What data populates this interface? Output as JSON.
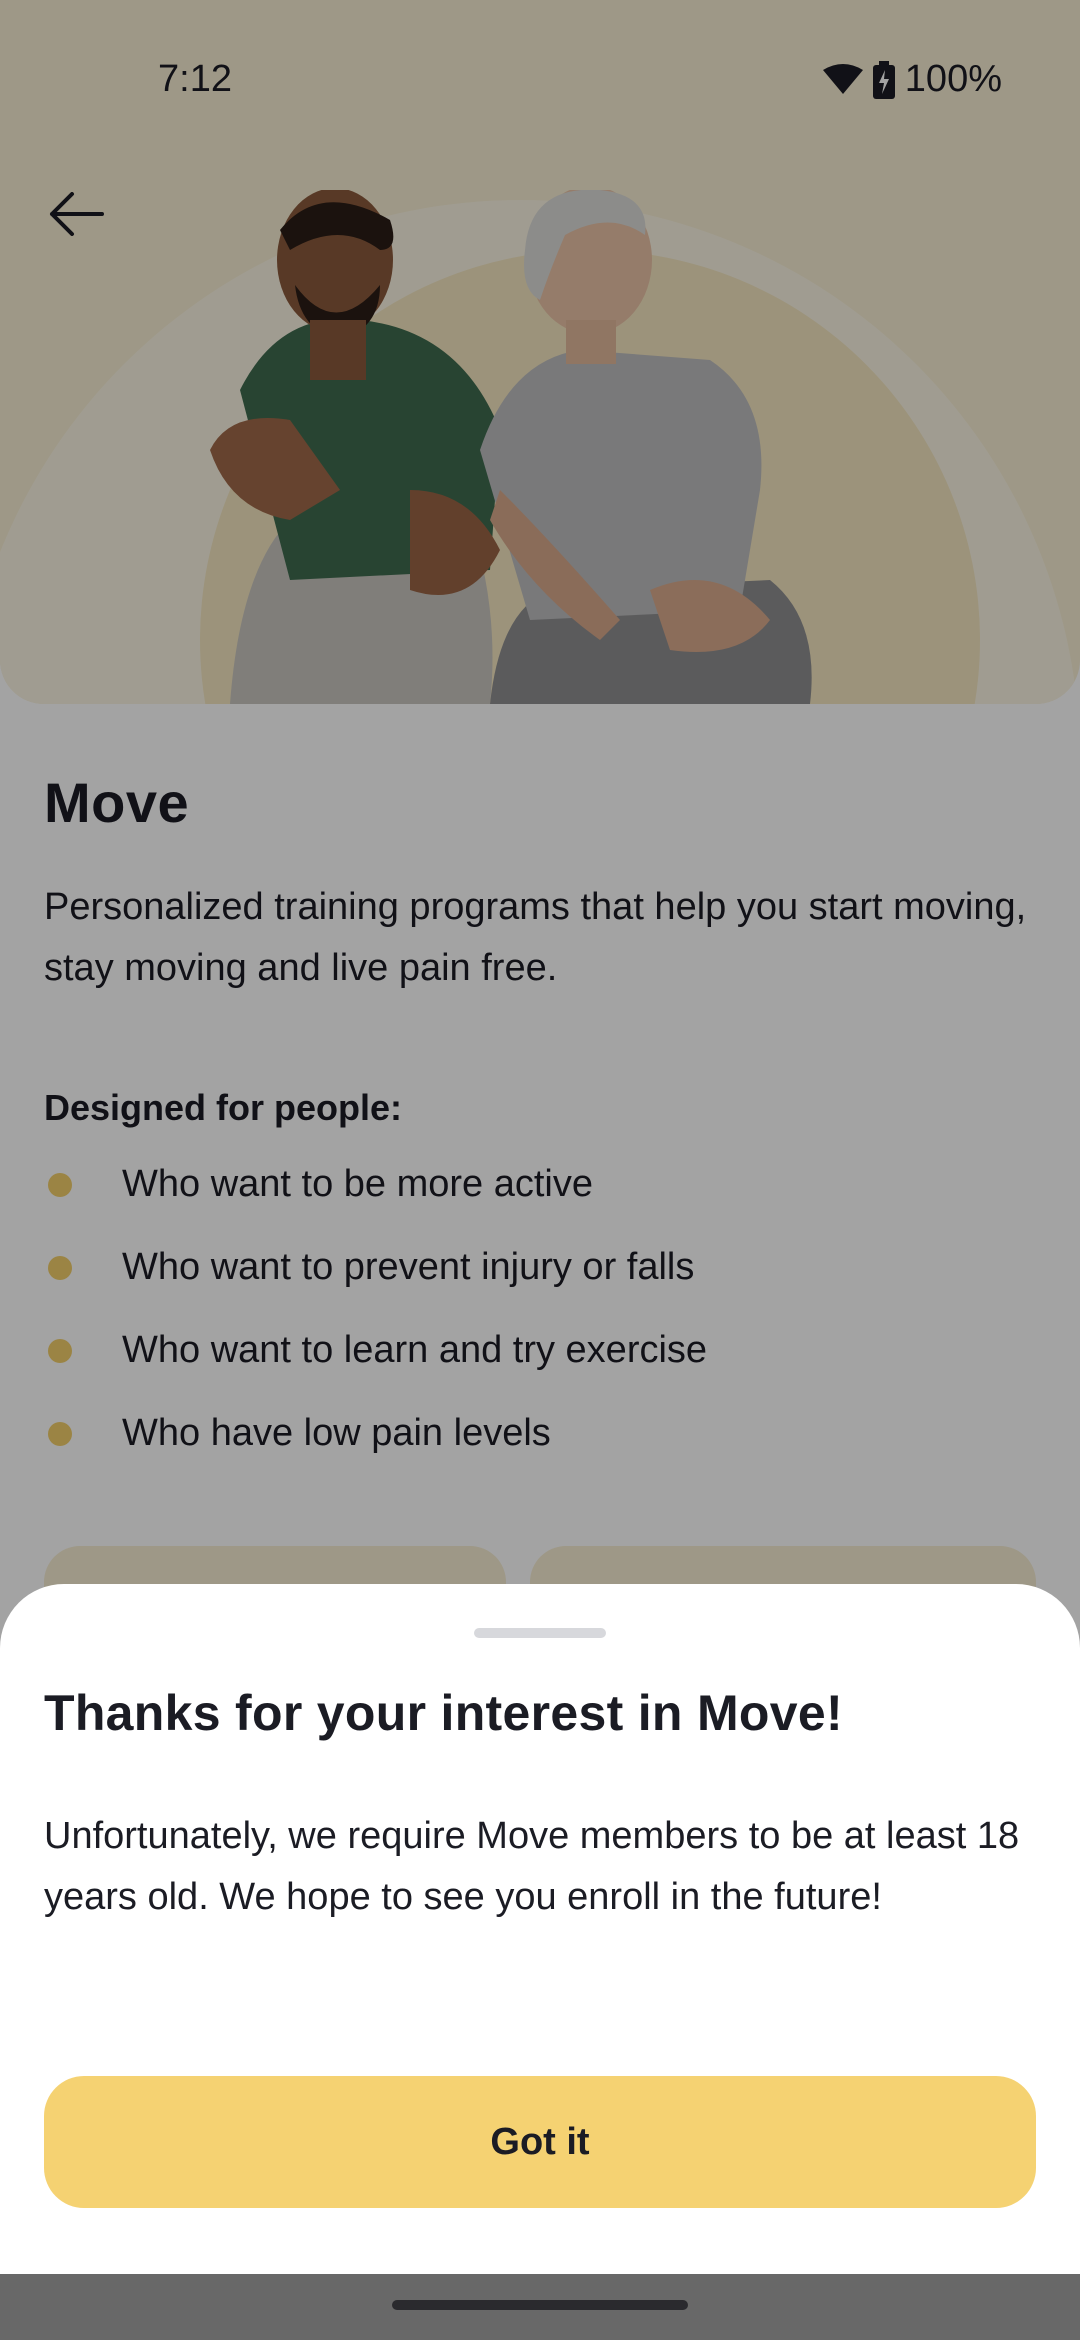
{
  "status_bar": {
    "time": "7:12",
    "battery": "100%",
    "icons": [
      "wifi-icon",
      "battery-charging-icon"
    ]
  },
  "header": {
    "back_icon": "arrow-left-icon"
  },
  "program": {
    "title": "Move",
    "description": "Personalized training programs that help you start moving, stay moving and live pain free.",
    "designed_heading": "Designed for people:",
    "bullets": [
      "Who want to be more active",
      "Who want to prevent injury or falls",
      "Who want to learn and try exercise",
      "Who have low pain levels"
    ]
  },
  "sheet": {
    "title": "Thanks for your interest in Move!",
    "body": "Unfortunately, we require Move members to be at least 18 years old. We hope to see you enroll in the future!",
    "button_label": "Got it"
  },
  "colors": {
    "accent": "#f5d272",
    "hero_bg": "#f7eed3",
    "bullet_dot": "#f2cf6b",
    "text": "#1b1c24"
  }
}
